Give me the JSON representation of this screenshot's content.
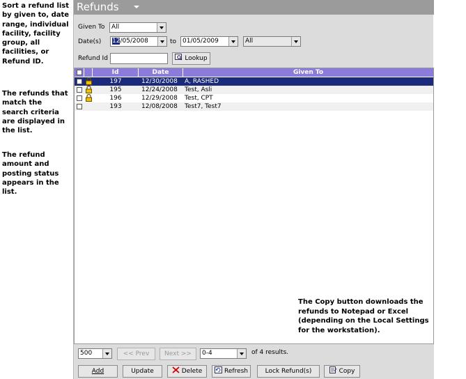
{
  "help": {
    "p1": "Sort a refund list by given to, date range, individual facility, facility group, all facilities, or Refund ID.",
    "p2": "The refunds that match the search criteria are displayed in the list.",
    "p3": "The refund amount and posting status appears in the list."
  },
  "title": "Refunds",
  "filters": {
    "given_to_label": "Given To",
    "given_to_value": "All",
    "dates_label": "Date(s)",
    "date_from_highlight": "12",
    "date_from_rest": "/05/2008",
    "to_label": "to",
    "date_to": "01/05/2009",
    "facility_value": "All",
    "refund_id_label": "Refund Id",
    "refund_id_value": "",
    "lookup_label": "Lookup"
  },
  "columns": [
    "Id",
    "Date",
    "Given To"
  ],
  "rows": [
    {
      "id": "197",
      "date": "12/30/2008",
      "given_to": "A, RASHED",
      "locked": true,
      "selected": true
    },
    {
      "id": "195",
      "date": "12/24/2008",
      "given_to": "Test, Asli",
      "locked": true,
      "selected": false
    },
    {
      "id": "196",
      "date": "12/29/2008",
      "given_to": "Test, CPT",
      "locked": true,
      "selected": false
    },
    {
      "id": "193",
      "date": "12/08/2008",
      "given_to": "Test7, Test7",
      "locked": false,
      "selected": false
    }
  ],
  "copy_note": "The Copy button downloads the refunds to Notepad or Excel (depending on the Local Settings for the workstation).",
  "pager": {
    "page_size": "500",
    "prev_label": "<< Prev",
    "next_label": "Next >>",
    "range": "0-4",
    "results_text": "of 4 results."
  },
  "actions": {
    "add": "Add",
    "update": "Update",
    "delete": "Delete",
    "refresh": "Refresh",
    "lock": "Lock Refund(s)",
    "copy": "Copy"
  },
  "colors": {
    "title_bar": "#9b9b9b",
    "list_header": "#8a7cd8",
    "selected_row": "#1c2a7c"
  }
}
